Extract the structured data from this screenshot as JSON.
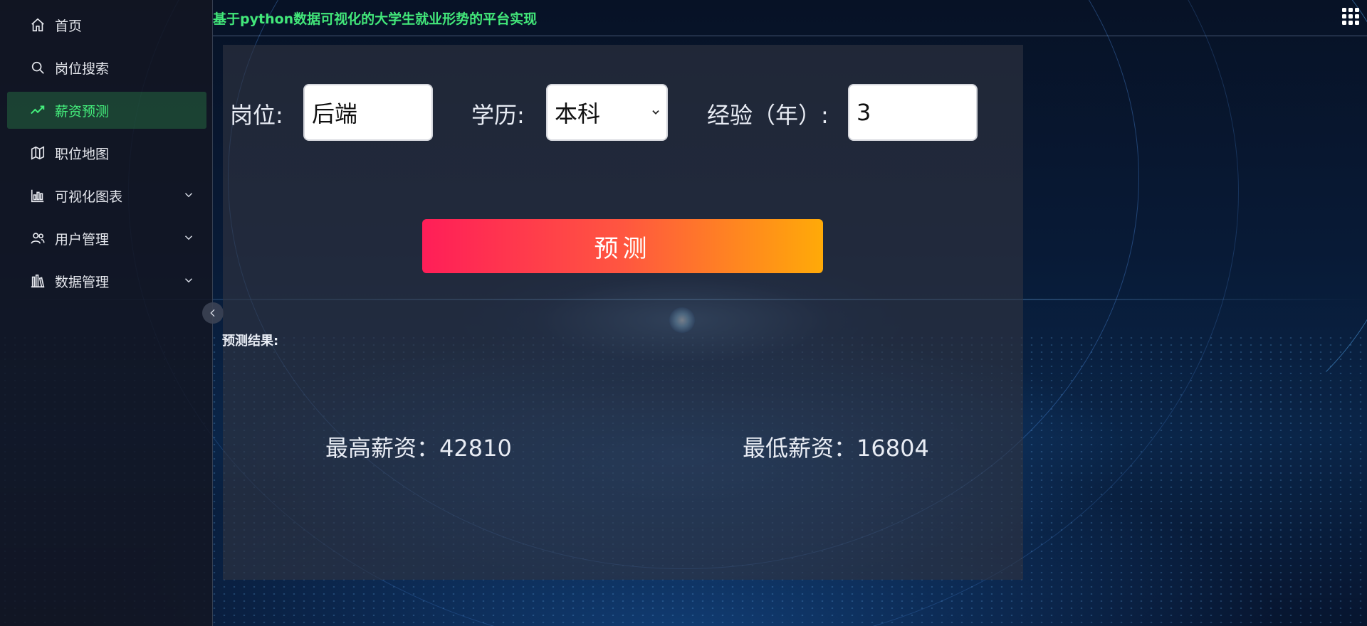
{
  "header": {
    "title": "基于python数据可视化的大学生就业形势的平台实现",
    "apps_icon": "grid-icon"
  },
  "sidebar": {
    "items": [
      {
        "label": "首页",
        "icon": "home-icon",
        "active": false
      },
      {
        "label": "岗位搜索",
        "icon": "search-icon",
        "active": false
      },
      {
        "label": "薪资预测",
        "icon": "trend-icon",
        "active": true
      },
      {
        "label": "职位地图",
        "icon": "map-icon",
        "active": false
      },
      {
        "label": "可视化图表",
        "icon": "bar-chart-icon",
        "active": false,
        "expandable": true
      },
      {
        "label": "用户管理",
        "icon": "users-icon",
        "active": false,
        "expandable": true
      },
      {
        "label": "数据管理",
        "icon": "data-icon",
        "active": false,
        "expandable": true
      }
    ],
    "active_color": "#44ef7c"
  },
  "form": {
    "position_label": "岗位:",
    "position_value": "后端",
    "education_label": "学历:",
    "education_value": "本科",
    "experience_label": "经验（年）:",
    "experience_value": "3",
    "predict_button": "预测"
  },
  "result": {
    "label": "预测结果:",
    "max_salary_label": "最高薪资：",
    "max_salary": "42810",
    "min_salary_label": "最低薪资：",
    "min_salary": "16804"
  },
  "colors": {
    "title_green": "#42e77a",
    "button_gradient_start": "#ff1e58",
    "button_gradient_end": "#ffaa08"
  }
}
